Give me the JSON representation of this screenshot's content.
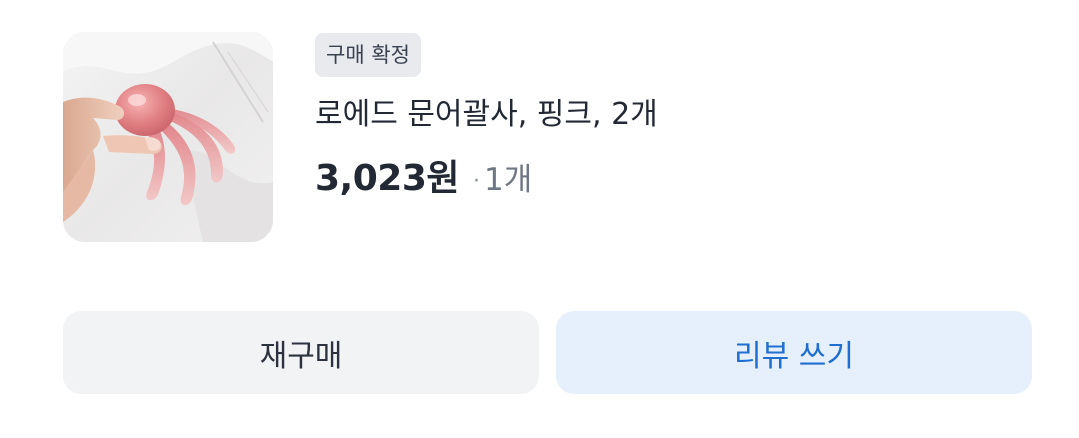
{
  "order_item": {
    "status_badge": "구매 확정",
    "product_name": "로에드 문어괄사, 핑크, 2개",
    "price": "3,023원",
    "separator": "·",
    "quantity": "1개",
    "thumbnail_alt": "pink octopus-shaped gua sha held in hand"
  },
  "actions": {
    "rebuy_label": "재구매",
    "review_label": "리뷰 쓰기"
  },
  "colors": {
    "badge_bg": "#e8eaee",
    "rebuy_bg": "#f2f3f5",
    "review_bg": "#e5f0fc",
    "review_text": "#1f6ed0"
  }
}
